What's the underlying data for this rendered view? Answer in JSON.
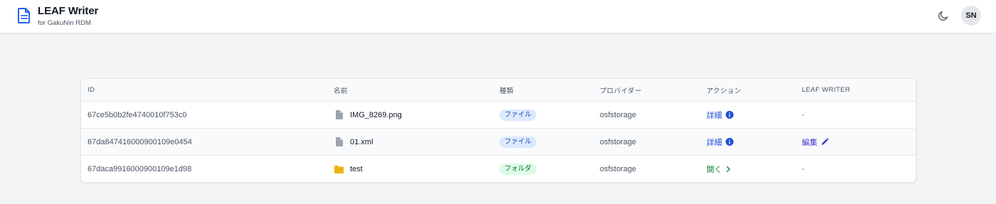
{
  "header": {
    "title": "LEAF Writer",
    "subtitle": "for GakuNin RDM",
    "avatar_initials": "SN",
    "theme_icon": "moon-icon",
    "logo_icon": "document-icon"
  },
  "colors": {
    "brand": "#2563eb",
    "file_badge_bg": "#dbeafe",
    "folder_badge_bg": "#dcfce7",
    "folder_icon": "#eab308"
  },
  "table": {
    "headers": {
      "id": "ID",
      "name": "名前",
      "type": "種類",
      "provider": "プロバイダー",
      "action": "アクション",
      "leaf": "LEAF WRITER"
    },
    "rows": [
      {
        "id": "67ce5b0b2fe4740010f753c0",
        "icon": "file-icon",
        "name": "IMG_8269.png",
        "type": "ファイル",
        "provider": "osfstorage",
        "action": "詳細",
        "action_icon": "info-icon",
        "leaf": "-"
      },
      {
        "id": "67da847416000900109e0454",
        "icon": "file-icon",
        "name": "01.xml",
        "type": "ファイル",
        "provider": "osfstorage",
        "action": "詳細",
        "action_icon": "info-icon",
        "leaf": "編集",
        "leaf_icon": "pencil-icon"
      },
      {
        "id": "67daca9916000900109e1d98",
        "icon": "folder-icon",
        "name": "test",
        "type": "フォルダ",
        "provider": "osfstorage",
        "action": "開く",
        "action_icon": "chevron-right-icon",
        "leaf": "-"
      }
    ]
  }
}
